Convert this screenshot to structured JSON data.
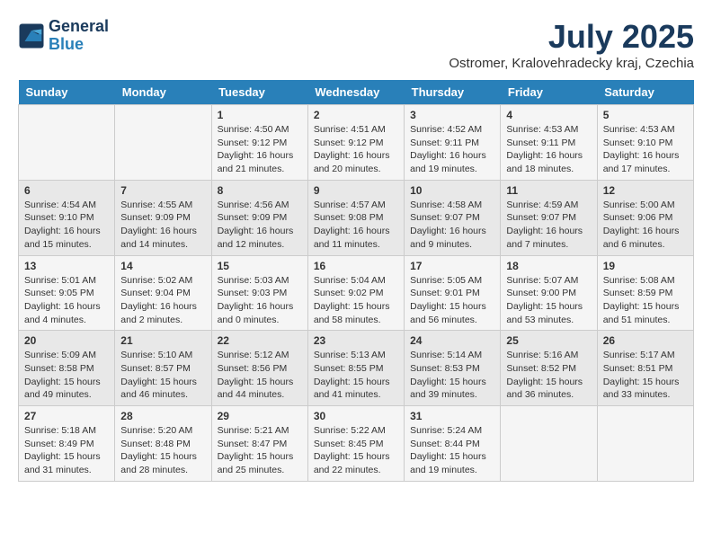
{
  "header": {
    "logo_line1": "General",
    "logo_line2": "Blue",
    "month_title": "July 2025",
    "location": "Ostromer, Kralovehradecky kraj, Czechia"
  },
  "weekdays": [
    "Sunday",
    "Monday",
    "Tuesday",
    "Wednesday",
    "Thursday",
    "Friday",
    "Saturday"
  ],
  "weeks": [
    [
      {
        "day": "",
        "detail": ""
      },
      {
        "day": "",
        "detail": ""
      },
      {
        "day": "1",
        "detail": "Sunrise: 4:50 AM\nSunset: 9:12 PM\nDaylight: 16 hours and 21 minutes."
      },
      {
        "day": "2",
        "detail": "Sunrise: 4:51 AM\nSunset: 9:12 PM\nDaylight: 16 hours and 20 minutes."
      },
      {
        "day": "3",
        "detail": "Sunrise: 4:52 AM\nSunset: 9:11 PM\nDaylight: 16 hours and 19 minutes."
      },
      {
        "day": "4",
        "detail": "Sunrise: 4:53 AM\nSunset: 9:11 PM\nDaylight: 16 hours and 18 minutes."
      },
      {
        "day": "5",
        "detail": "Sunrise: 4:53 AM\nSunset: 9:10 PM\nDaylight: 16 hours and 17 minutes."
      }
    ],
    [
      {
        "day": "6",
        "detail": "Sunrise: 4:54 AM\nSunset: 9:10 PM\nDaylight: 16 hours and 15 minutes."
      },
      {
        "day": "7",
        "detail": "Sunrise: 4:55 AM\nSunset: 9:09 PM\nDaylight: 16 hours and 14 minutes."
      },
      {
        "day": "8",
        "detail": "Sunrise: 4:56 AM\nSunset: 9:09 PM\nDaylight: 16 hours and 12 minutes."
      },
      {
        "day": "9",
        "detail": "Sunrise: 4:57 AM\nSunset: 9:08 PM\nDaylight: 16 hours and 11 minutes."
      },
      {
        "day": "10",
        "detail": "Sunrise: 4:58 AM\nSunset: 9:07 PM\nDaylight: 16 hours and 9 minutes."
      },
      {
        "day": "11",
        "detail": "Sunrise: 4:59 AM\nSunset: 9:07 PM\nDaylight: 16 hours and 7 minutes."
      },
      {
        "day": "12",
        "detail": "Sunrise: 5:00 AM\nSunset: 9:06 PM\nDaylight: 16 hours and 6 minutes."
      }
    ],
    [
      {
        "day": "13",
        "detail": "Sunrise: 5:01 AM\nSunset: 9:05 PM\nDaylight: 16 hours and 4 minutes."
      },
      {
        "day": "14",
        "detail": "Sunrise: 5:02 AM\nSunset: 9:04 PM\nDaylight: 16 hours and 2 minutes."
      },
      {
        "day": "15",
        "detail": "Sunrise: 5:03 AM\nSunset: 9:03 PM\nDaylight: 16 hours and 0 minutes."
      },
      {
        "day": "16",
        "detail": "Sunrise: 5:04 AM\nSunset: 9:02 PM\nDaylight: 15 hours and 58 minutes."
      },
      {
        "day": "17",
        "detail": "Sunrise: 5:05 AM\nSunset: 9:01 PM\nDaylight: 15 hours and 56 minutes."
      },
      {
        "day": "18",
        "detail": "Sunrise: 5:07 AM\nSunset: 9:00 PM\nDaylight: 15 hours and 53 minutes."
      },
      {
        "day": "19",
        "detail": "Sunrise: 5:08 AM\nSunset: 8:59 PM\nDaylight: 15 hours and 51 minutes."
      }
    ],
    [
      {
        "day": "20",
        "detail": "Sunrise: 5:09 AM\nSunset: 8:58 PM\nDaylight: 15 hours and 49 minutes."
      },
      {
        "day": "21",
        "detail": "Sunrise: 5:10 AM\nSunset: 8:57 PM\nDaylight: 15 hours and 46 minutes."
      },
      {
        "day": "22",
        "detail": "Sunrise: 5:12 AM\nSunset: 8:56 PM\nDaylight: 15 hours and 44 minutes."
      },
      {
        "day": "23",
        "detail": "Sunrise: 5:13 AM\nSunset: 8:55 PM\nDaylight: 15 hours and 41 minutes."
      },
      {
        "day": "24",
        "detail": "Sunrise: 5:14 AM\nSunset: 8:53 PM\nDaylight: 15 hours and 39 minutes."
      },
      {
        "day": "25",
        "detail": "Sunrise: 5:16 AM\nSunset: 8:52 PM\nDaylight: 15 hours and 36 minutes."
      },
      {
        "day": "26",
        "detail": "Sunrise: 5:17 AM\nSunset: 8:51 PM\nDaylight: 15 hours and 33 minutes."
      }
    ],
    [
      {
        "day": "27",
        "detail": "Sunrise: 5:18 AM\nSunset: 8:49 PM\nDaylight: 15 hours and 31 minutes."
      },
      {
        "day": "28",
        "detail": "Sunrise: 5:20 AM\nSunset: 8:48 PM\nDaylight: 15 hours and 28 minutes."
      },
      {
        "day": "29",
        "detail": "Sunrise: 5:21 AM\nSunset: 8:47 PM\nDaylight: 15 hours and 25 minutes."
      },
      {
        "day": "30",
        "detail": "Sunrise: 5:22 AM\nSunset: 8:45 PM\nDaylight: 15 hours and 22 minutes."
      },
      {
        "day": "31",
        "detail": "Sunrise: 5:24 AM\nSunset: 8:44 PM\nDaylight: 15 hours and 19 minutes."
      },
      {
        "day": "",
        "detail": ""
      },
      {
        "day": "",
        "detail": ""
      }
    ]
  ]
}
